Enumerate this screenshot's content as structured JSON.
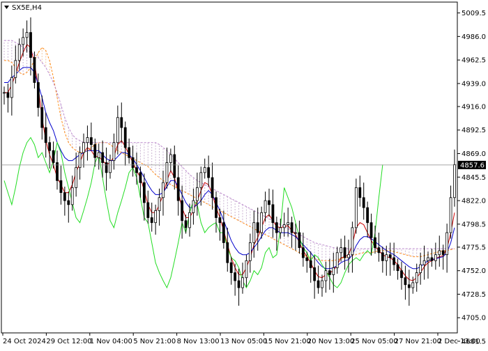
{
  "header": {
    "symbol_label": "SX5E,H4"
  },
  "chart_data": {
    "type": "line",
    "title": "SX5E,H4",
    "ylim": [
      4681.5,
      5012.0
    ],
    "y_ticks": [
      "5009.5",
      "4986.0",
      "4962.5",
      "4939.0",
      "4916.0",
      "4892.5",
      "4869.0",
      "4845.5",
      "4822.0",
      "4798.5",
      "4775.5",
      "4752.0",
      "4728.5",
      "4705.0",
      "4681.5"
    ],
    "x_tick_labels": [
      "24 Oct 2024",
      "29 Oct 12:00",
      "1 Nov 04:00",
      "5 Nov 21:00",
      "8 Nov 13:00",
      "13 Nov 05:00",
      "15 Nov 21:00",
      "20 Nov 13:00",
      "25 Nov 05:00",
      "27 Nov 21:00",
      "2 Dec 13:00"
    ],
    "current_price": {
      "label": "4857.6",
      "value": 4857.6
    },
    "series": [
      {
        "key": "price",
        "style": "candles",
        "color": "#000000",
        "values": [
          4930,
          4925,
          4945,
          4962,
          4978,
          4985,
          4990,
          4965,
          4940,
          4915,
          4895,
          4880,
          4872,
          4860,
          4842,
          4830,
          4822,
          4818,
          4835,
          4855,
          4870,
          4880,
          4885,
          4878,
          4865,
          4870,
          4860,
          4850,
          4862,
          4880,
          4905,
          4895,
          4875,
          4865,
          4855,
          4850,
          4840,
          4820,
          4805,
          4800,
          4812,
          4825,
          4840,
          4860,
          4868,
          4845,
          4822,
          4802,
          4795,
          4810,
          4822,
          4835,
          4850,
          4855,
          4845,
          4825,
          4805,
          4800,
          4780,
          4760,
          4750,
          4742,
          4735,
          4745,
          4762,
          4780,
          4800,
          4790,
          4810,
          4822,
          4818,
          4800,
          4790,
          4795,
          4798,
          4800,
          4790,
          4790,
          4775,
          4765,
          4762,
          4755,
          4742,
          4735,
          4742,
          4752,
          4748,
          4755,
          4770,
          4775,
          4765,
          4768,
          4795,
          4835,
          4825,
          4815,
          4800,
          4785,
          4775,
          4770,
          4762,
          4768,
          4765,
          4758,
          4752,
          4745,
          4738,
          4735,
          4740,
          4750,
          4758,
          4762,
          4765,
          4762,
          4768,
          4772,
          4768,
          4790,
          4825,
          4858
        ]
      },
      {
        "key": "tenkan-sen",
        "color": "#cc0000",
        "values": [
          4930,
          4930,
          4938,
          4948,
          4960,
          4970,
          4978,
          4975,
          4960,
          4935,
          4905,
          4882,
          4868,
          4858,
          4845,
          4838,
          4830,
          4830,
          4838,
          4850,
          4860,
          4870,
          4875,
          4872,
          4866,
          4866,
          4862,
          4858,
          4860,
          4866,
          4878,
          4882,
          4876,
          4868,
          4860,
          4852,
          4845,
          4832,
          4818,
          4810,
          4810,
          4818,
          4828,
          4842,
          4852,
          4845,
          4830,
          4815,
          4805,
          4805,
          4812,
          4822,
          4832,
          4840,
          4838,
          4828,
          4815,
          4805,
          4792,
          4778,
          4765,
          4755,
          4748,
          4748,
          4755,
          4765,
          4778,
          4785,
          4795,
          4805,
          4808,
          4802,
          4796,
          4795,
          4796,
          4797,
          4792,
          4788,
          4780,
          4772,
          4766,
          4760,
          4752,
          4746,
          4745,
          4748,
          4750,
          4752,
          4758,
          4765,
          4766,
          4768,
          4778,
          4795,
          4800,
          4798,
          4790,
          4782,
          4776,
          4772,
          4768,
          4766,
          4765,
          4762,
          4758,
          4752,
          4747,
          4743,
          4742,
          4745,
          4750,
          4756,
          4760,
          4762,
          4764,
          4766,
          4767,
          4774,
          4790,
          4810
        ]
      },
      {
        "key": "kijun-sen",
        "color": "#0000cc",
        "values": [
          4940,
          4940,
          4945,
          4948,
          4952,
          4955,
          4955,
          4955,
          4950,
          4938,
          4925,
          4910,
          4900,
          4892,
          4880,
          4872,
          4865,
          4862,
          4862,
          4865,
          4868,
          4870,
          4872,
          4872,
          4872,
          4872,
          4868,
          4864,
          4862,
          4862,
          4866,
          4870,
          4870,
          4868,
          4864,
          4858,
          4852,
          4845,
          4838,
          4832,
          4828,
          4828,
          4830,
          4836,
          4842,
          4842,
          4836,
          4828,
          4820,
          4815,
          4815,
          4818,
          4822,
          4828,
          4832,
          4828,
          4820,
          4812,
          4802,
          4792,
          4782,
          4775,
          4770,
          4768,
          4768,
          4770,
          4775,
          4780,
          4786,
          4792,
          4795,
          4795,
          4792,
          4790,
          4790,
          4790,
          4788,
          4786,
          4782,
          4778,
          4774,
          4770,
          4765,
          4760,
          4756,
          4754,
          4754,
          4755,
          4757,
          4760,
          4762,
          4763,
          4768,
          4777,
          4783,
          4786,
          4786,
          4784,
          4781,
          4778,
          4775,
          4772,
          4770,
          4768,
          4765,
          4762,
          4759,
          4756,
          4754,
          4754,
          4756,
          4759,
          4762,
          4763,
          4764,
          4765,
          4766,
          4770,
          4780,
          4795
        ]
      },
      {
        "key": "senkou-span-a",
        "color": "#ff8c1a",
        "dashed": true,
        "values": [
          4962,
          4962,
          4960,
          4955,
          4950,
          4948,
          4950,
          4955,
          4962,
          4970,
          4975,
          4972,
          4962,
          4945,
          4925,
          4905,
          4890,
          4880,
          4875,
          4872,
          4870,
          4870,
          4872,
          4875,
          4878,
          4880,
          4880,
          4880,
          4878,
          4875,
          4872,
          4870,
          4868,
          4866,
          4864,
          4862,
          4860,
          4858,
          4856,
          4852,
          4848,
          4845,
          4842,
          4840,
          4838,
          4836,
          4834,
          4832,
          4830,
          4828,
          4826,
          4824,
          4822,
          4820,
          4818,
          4816,
          4814,
          4812,
          4810,
          4808,
          4806,
          4804,
          4802,
          4800,
          4798,
          4796,
          4794,
          4792,
          4790,
          4788,
          4786,
          4784,
          4782,
          4780,
          4778,
          4776,
          4774,
          4772,
          4770,
          4768,
          4766,
          4765,
          4764,
          4763,
          4762,
          4762,
          4762,
          4762,
          4763,
          4764,
          4765,
          4766,
          4767,
          4768,
          4769,
          4770,
          4770,
          4770,
          4771,
          4772,
          4772,
          4772,
          4772,
          4771,
          4770,
          4769,
          4768,
          4767,
          4766,
          4766,
          4766,
          4767,
          4768,
          4769,
          4770,
          4771,
          4772,
          4772,
          4773,
          4774
        ]
      },
      {
        "key": "senkou-span-b",
        "color": "#bb88cc",
        "dashed": true,
        "values": [
          4982,
          4982,
          4982,
          4980,
          4978,
          4975,
          4972,
          4970,
          4968,
          4965,
          4960,
          4955,
          4948,
          4940,
          4930,
          4918,
          4905,
          4895,
          4888,
          4884,
          4882,
          4880,
          4880,
          4880,
          4880,
          4880,
          4880,
          4880,
          4880,
          4880,
          4880,
          4880,
          4880,
          4880,
          4880,
          4880,
          4880,
          4880,
          4880,
          4880,
          4880,
          4878,
          4875,
          4872,
          4868,
          4864,
          4860,
          4856,
          4852,
          4848,
          4845,
          4842,
          4840,
          4838,
          4836,
          4834,
          4832,
          4830,
          4828,
          4826,
          4824,
          4822,
          4820,
          4818,
          4816,
          4814,
          4812,
          4810,
          4808,
          4806,
          4804,
          4802,
          4800,
          4798,
          4796,
          4794,
          4792,
          4790,
          4788,
          4786,
          4784,
          4782,
          4780,
          4779,
          4778,
          4777,
          4776,
          4775,
          4774,
          4774,
          4774,
          4774,
          4774,
          4774,
          4774,
          4774,
          4774,
          4774,
          4774,
          4774,
          4774,
          4774,
          4774,
          4774,
          4774,
          4774,
          4774,
          4774,
          4774,
          4774,
          4774,
          4774,
          4774,
          4774,
          4774,
          4774,
          4774,
          4774,
          4774,
          4774
        ]
      },
      {
        "key": "chikou-span",
        "color": "#22dd22",
        "values": [
          4842,
          4830,
          4818,
          4835,
          4855,
          4870,
          4880,
          4885,
          4878,
          4865,
          4870,
          4860,
          4850,
          4862,
          4880,
          4870,
          4850,
          4835,
          4820,
          4805,
          4800,
          4812,
          4825,
          4840,
          4860,
          4868,
          4845,
          4822,
          4802,
          4795,
          4810,
          4822,
          4835,
          4850,
          4855,
          4845,
          4825,
          4805,
          4800,
          4780,
          4760,
          4750,
          4742,
          4735,
          4745,
          4762,
          4780,
          4800,
          4790,
          4810,
          4822,
          4818,
          4800,
          4790,
          4795,
          4798,
          4800,
          4790,
          4790,
          4775,
          4765,
          4762,
          4755,
          4742,
          4735,
          4742,
          4752,
          4748,
          4755,
          4770,
          4775,
          4765,
          4768,
          4795,
          4835,
          4825,
          4815,
          4800,
          4785,
          4775,
          4770,
          4762,
          4768,
          4765,
          4758,
          4752,
          4745,
          4738,
          4735,
          4740,
          4750,
          4758,
          4762,
          4765,
          4762,
          4768,
          4772,
          4768,
          4790,
          4825,
          4858
        ]
      }
    ]
  }
}
